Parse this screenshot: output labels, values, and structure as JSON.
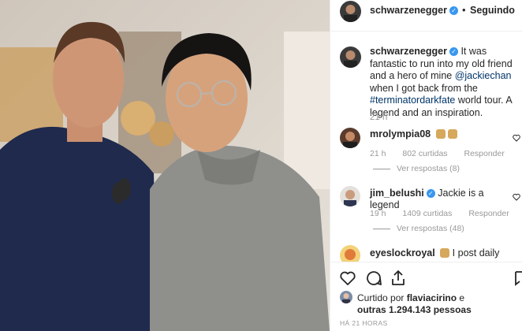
{
  "post": {
    "author": "schwarzenegger",
    "follow_label": "Seguindo",
    "caption_parts": [
      "It was fantastic to run into my old friend and a hero of mine ",
      "@jackiechan",
      " when I got back from the ",
      "#terminatordarkfate",
      " world tour. A legend and an inspiration."
    ],
    "caption_time": "21 h"
  },
  "comments": [
    {
      "user": "mrolympia08",
      "text": "",
      "time": "21 h",
      "likes": "802 curtidas",
      "reply": "Responder",
      "view_replies": "Ver respostas (8)"
    },
    {
      "user": "jim_belushi",
      "text": "Jackie is a legend",
      "time": "19 h",
      "likes": "1409 curtidas",
      "reply": "Responder",
      "view_replies": "Ver respostas (48)"
    },
    {
      "user": "eyeslockroyal",
      "text": "I post daily"
    }
  ],
  "liked_by": {
    "prefix": "Curtido por",
    "user": "flaviacirino",
    "connector": "e",
    "others": "outras 1.294.143 pessoas"
  },
  "posted_ago": "HÁ 21 HORAS",
  "icons": {
    "verified": "check",
    "like": "heart-icon",
    "comment": "comment-icon",
    "share": "share-icon",
    "save": "bookmark-icon"
  },
  "colors": {
    "link": "#003569",
    "verified": "#3897f0",
    "muted": "#999999"
  }
}
